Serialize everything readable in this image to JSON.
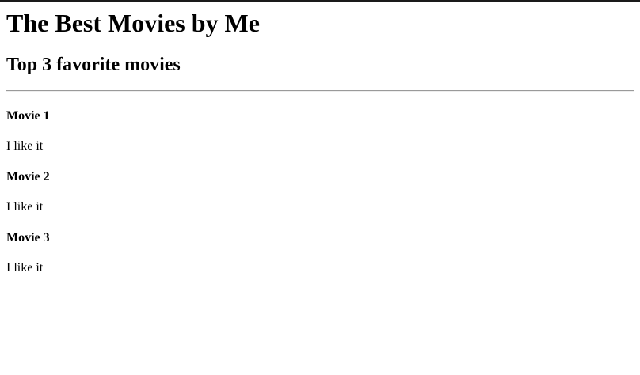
{
  "page": {
    "title": "The Best Movies by Me",
    "subtitle": "Top 3 favorite movies"
  },
  "movies": [
    {
      "name": "Movie 1",
      "comment": "I like it"
    },
    {
      "name": "Movie 2",
      "comment": "I like it"
    },
    {
      "name": "Movie 3",
      "comment": "I like it"
    }
  ]
}
